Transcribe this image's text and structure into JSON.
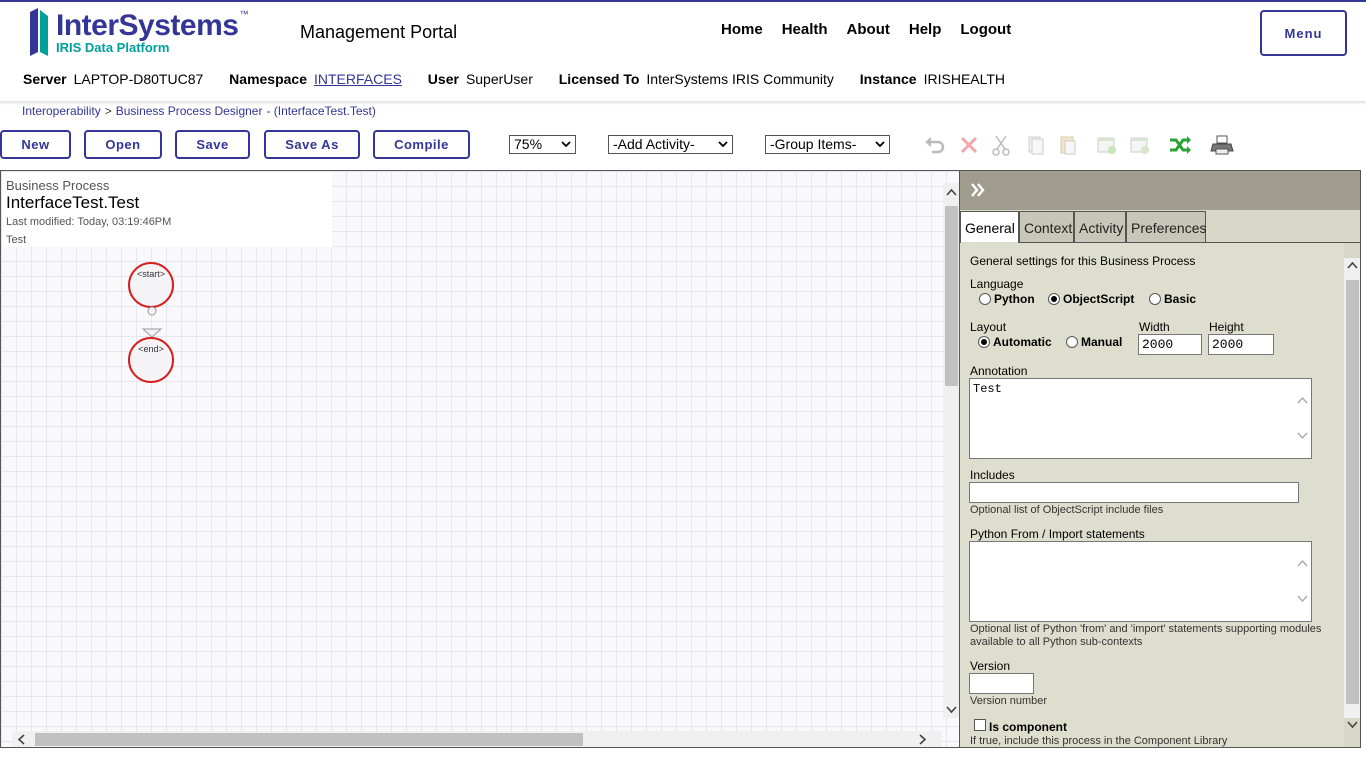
{
  "header": {
    "logo_name": "InterSystems",
    "logo_tm": "™",
    "logo_sub": "IRIS Data Platform",
    "portal_title": "Management Portal",
    "nav": [
      "Home",
      "Health",
      "About",
      "Help",
      "Logout"
    ],
    "menu_label": "Menu"
  },
  "info": {
    "server_label": "Server",
    "server": "LAPTOP-D80TUC87",
    "namespace_label": "Namespace",
    "namespace": "INTERFACES",
    "user_label": "User",
    "user": "SuperUser",
    "licensed_label": "Licensed To",
    "licensed": "InterSystems IRIS Community",
    "instance_label": "Instance",
    "instance": "IRISHEALTH"
  },
  "breadcrumb": {
    "items": [
      "Interoperability",
      "Business Process Designer"
    ],
    "separator": ">",
    "current": "- (InterfaceTest.Test)"
  },
  "toolbar": {
    "new": "New",
    "open": "Open",
    "save": "Save",
    "save_as": "Save As",
    "compile": "Compile",
    "zoom": "75%",
    "add_activity": "-Add Activity-",
    "group_items": "-Group Items-",
    "icons": [
      "undo-icon",
      "delete-icon",
      "cut-icon",
      "copy-icon",
      "paste-icon",
      "group-icon",
      "ungroup-icon",
      "shuffle-icon",
      "print-icon"
    ]
  },
  "canvas": {
    "kind": "Business Process",
    "name": "InterfaceTest.Test",
    "modified": "Last modified: Today, 03:19:46PM",
    "annotation": "Test",
    "start_label": "<start>",
    "end_label": "<end>"
  },
  "panel": {
    "tabs": [
      "General",
      "Context",
      "Activity",
      "Preferences"
    ],
    "active_tab": "General",
    "intro": "General settings for this Business Process",
    "language_label": "Language",
    "languages": [
      "Python",
      "ObjectScript",
      "Basic"
    ],
    "language_selected": "ObjectScript",
    "layout_label": "Layout",
    "layouts": [
      "Automatic",
      "Manual"
    ],
    "layout_selected": "Automatic",
    "width_label": "Width",
    "width": "2000",
    "height_label": "Height",
    "height": "2000",
    "annotation_label": "Annotation",
    "annotation": "Test",
    "includes_label": "Includes",
    "includes": "",
    "includes_help": "Optional list of ObjectScript include files",
    "python_label": "Python From / Import statements",
    "python": "",
    "python_help_1": "Optional list of Python 'from' and 'import' statements supporting modules",
    "python_help_2": "available to all Python sub-contexts",
    "version_label": "Version",
    "version": "",
    "version_help": "Version number",
    "component_label": "Is component",
    "component_help": "If true, include this process in the Component Library"
  }
}
